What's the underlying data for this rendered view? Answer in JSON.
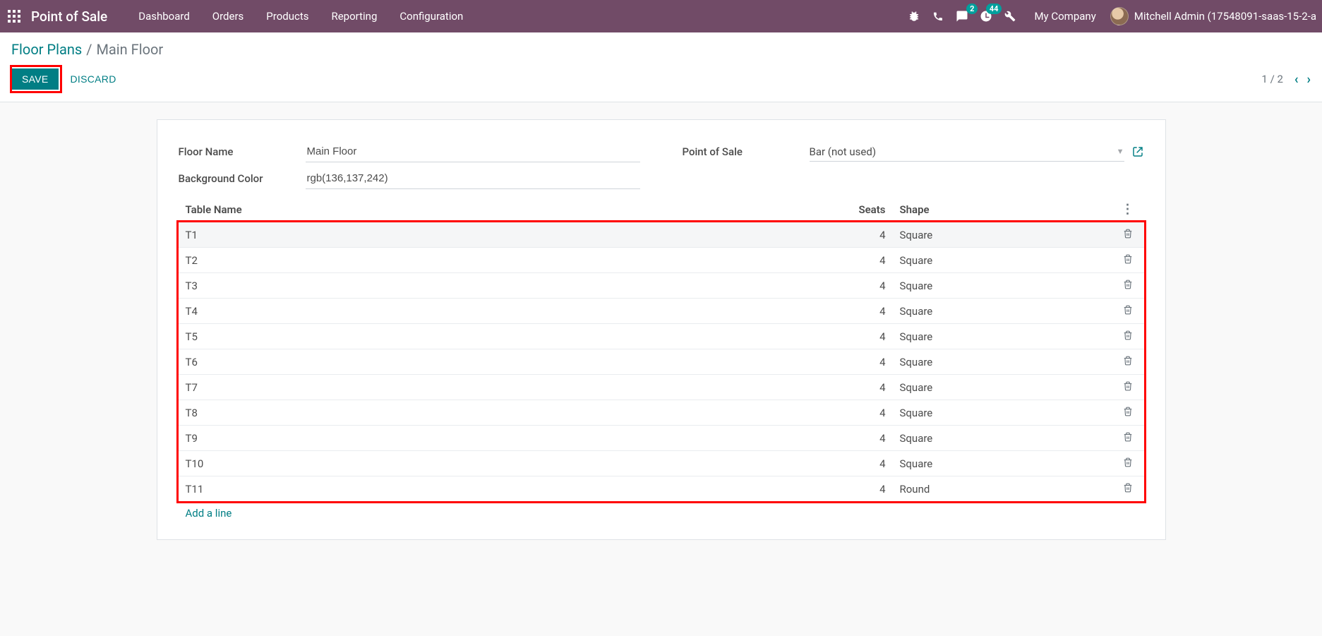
{
  "navbar": {
    "app_title": "Point of Sale",
    "menu": [
      "Dashboard",
      "Orders",
      "Products",
      "Reporting",
      "Configuration"
    ],
    "msg_badge": "2",
    "activity_badge": "44",
    "company": "My Company",
    "user": "Mitchell Admin (17548091-saas-15-2-a"
  },
  "breadcrumb": {
    "parent": "Floor Plans",
    "current": "Main Floor"
  },
  "buttons": {
    "save": "SAVE",
    "discard": "DISCARD"
  },
  "pager": {
    "text": "1 / 2"
  },
  "form": {
    "labels": {
      "floor_name": "Floor Name",
      "background_color": "Background Color",
      "point_of_sale": "Point of Sale"
    },
    "floor_name": "Main Floor",
    "background_color": "rgb(136,137,242)",
    "point_of_sale": "Bar (not used)"
  },
  "table": {
    "headers": {
      "name": "Table Name",
      "seats": "Seats",
      "shape": "Shape"
    },
    "rows": [
      {
        "name": "T1",
        "seats": "4",
        "shape": "Square"
      },
      {
        "name": "T2",
        "seats": "4",
        "shape": "Square"
      },
      {
        "name": "T3",
        "seats": "4",
        "shape": "Square"
      },
      {
        "name": "T4",
        "seats": "4",
        "shape": "Square"
      },
      {
        "name": "T5",
        "seats": "4",
        "shape": "Square"
      },
      {
        "name": "T6",
        "seats": "4",
        "shape": "Square"
      },
      {
        "name": "T7",
        "seats": "4",
        "shape": "Square"
      },
      {
        "name": "T8",
        "seats": "4",
        "shape": "Square"
      },
      {
        "name": "T9",
        "seats": "4",
        "shape": "Square"
      },
      {
        "name": "T10",
        "seats": "4",
        "shape": "Square"
      },
      {
        "name": "T11",
        "seats": "4",
        "shape": "Round"
      }
    ],
    "add_line": "Add a line"
  }
}
